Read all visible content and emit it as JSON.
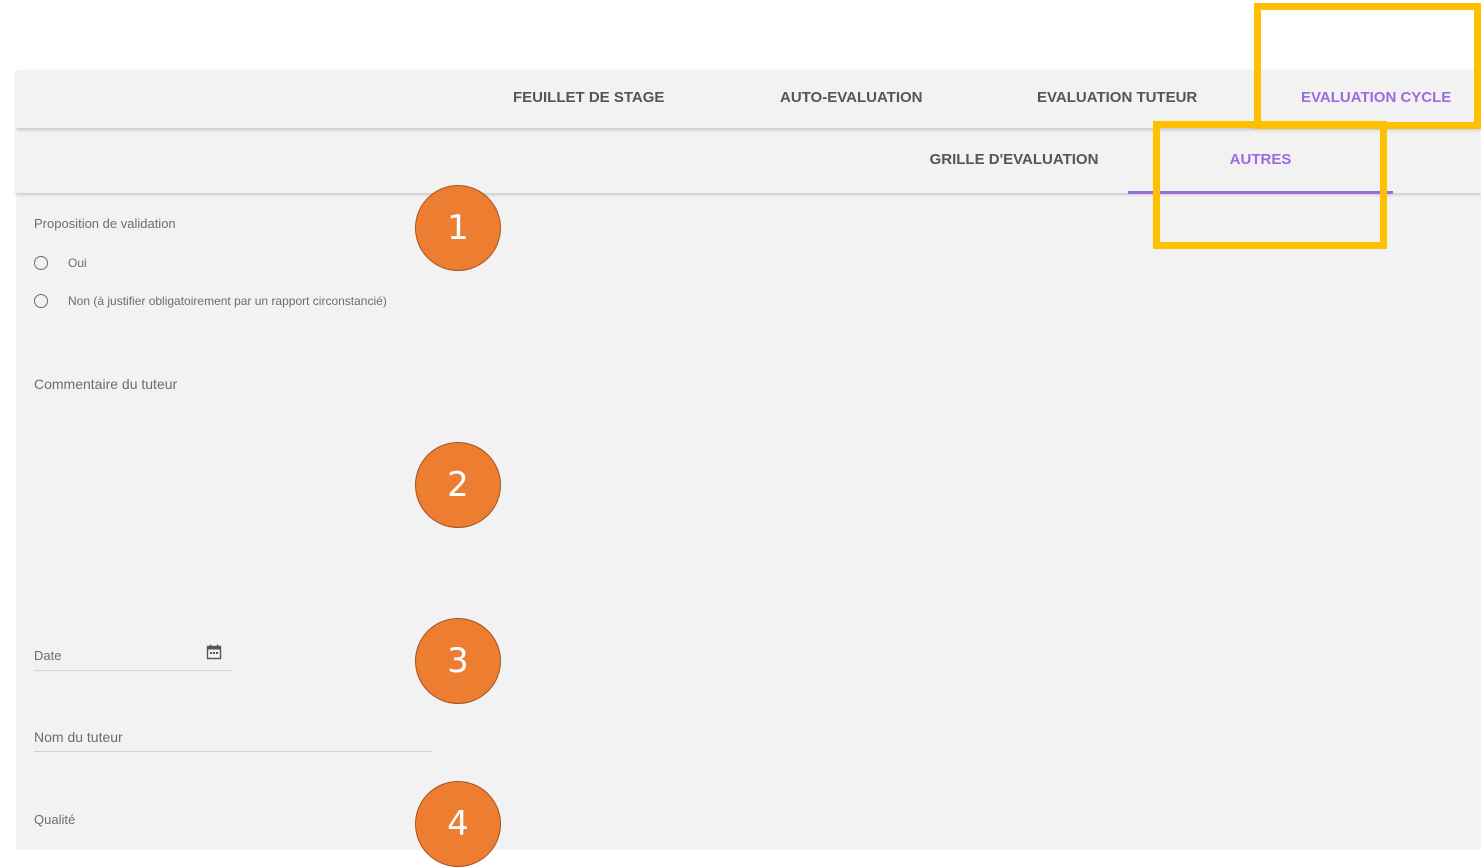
{
  "tabs": [
    {
      "label": "FEUILLET DE STAGE",
      "active": false
    },
    {
      "label": "AUTO-EVALUATION",
      "active": false
    },
    {
      "label": "EVALUATION TUTEUR",
      "active": false
    },
    {
      "label": "EVALUATION CYCLE",
      "active": true
    }
  ],
  "subtabs": [
    {
      "label": "GRILLE D'EVALUATION",
      "active": false
    },
    {
      "label": "AUTRES",
      "active": true
    }
  ],
  "form": {
    "validation_label": "Proposition de validation",
    "validation_options": [
      {
        "label": "Oui",
        "checked": false
      },
      {
        "label": "Non (à justifier obligatoirement par un rapport circonstancié)",
        "checked": false
      }
    ],
    "comment_label": "Commentaire du tuteur",
    "date_label": "Date",
    "tutor_name_label": "Nom du tuteur",
    "quality_label": "Qualité"
  },
  "annotations": {
    "markers": [
      "1",
      "2",
      "3",
      "4"
    ],
    "marker_color": "#ed7d31",
    "highlight_color": "#ffc000"
  },
  "colors": {
    "accent": "#9c6be0",
    "background": "#f2f2f2",
    "text": "#6d6d6d"
  },
  "icons": {
    "date_icon": "calendar-icon",
    "radio_icon": "radio-unchecked-icon"
  }
}
